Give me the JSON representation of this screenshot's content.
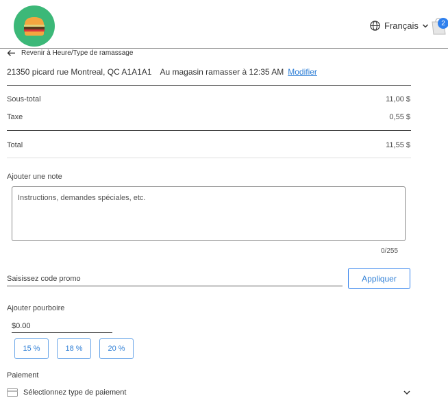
{
  "header": {
    "language": "Français",
    "cart_count": "2"
  },
  "back_link": "Revenir à Heure/Type de ramassage",
  "pickup": {
    "address": "21350 picard rue Montreal, QC A1A1A1",
    "time": "Au magasin ramasser à 12:35 AM",
    "modify_label": "Modifier"
  },
  "totals": {
    "subtotal_label": "Sous-total",
    "subtotal_value": "11,00 $",
    "tax_label": "Taxe",
    "tax_value": "0,55 $",
    "total_label": "Total",
    "total_value": "11,55 $"
  },
  "note": {
    "title": "Ajouter une note",
    "placeholder": "Instructions, demandes spéciales, etc.",
    "counter": "0/255"
  },
  "promo": {
    "placeholder": "Saisissez code promo",
    "apply_label": "Appliquer"
  },
  "tip": {
    "title": "Ajouter pourboire",
    "value": "$0.00",
    "options": [
      "15 %",
      "18 %",
      "20 %"
    ]
  },
  "payment": {
    "title": "Paiement",
    "select_label": "Sélectionnez type de paiement"
  },
  "colors": {
    "accent": "#2f80ed",
    "logo_bg": "#3cb878"
  },
  "icons": [
    "burger-logo",
    "globe-icon",
    "chevron-down-icon",
    "cart-icon",
    "back-arrow-icon",
    "card-icon"
  ]
}
